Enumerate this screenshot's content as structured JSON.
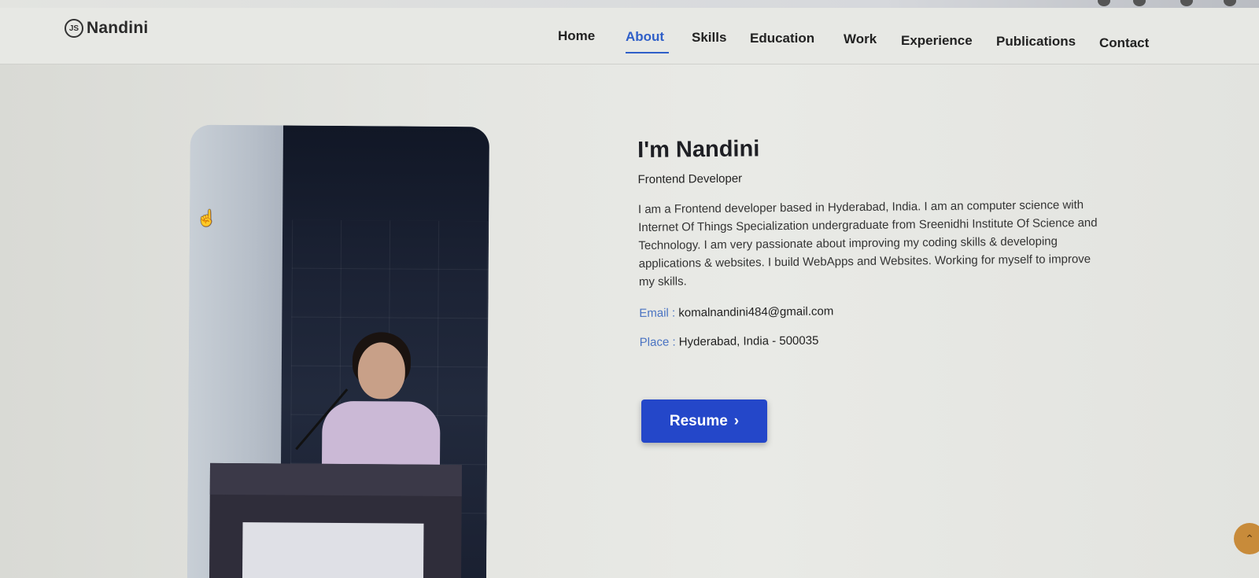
{
  "brand": {
    "logo_text": "JS",
    "name": "Nandini"
  },
  "nav": {
    "items": [
      {
        "label": "Home"
      },
      {
        "label": "About"
      },
      {
        "label": "Skills"
      },
      {
        "label": "Education"
      },
      {
        "label": "Work"
      },
      {
        "label": "Experience"
      },
      {
        "label": "Publications"
      },
      {
        "label": "Contact"
      }
    ],
    "active": "About"
  },
  "about": {
    "heading": "I'm Nandini",
    "role": "Frontend Developer",
    "bio": "I am a Frontend developer based in Hyderabad, India. I am an computer science with Internet Of Things Specialization undergraduate from Sreenidhi Institute Of Science and Technology. I am very passionate about improving my coding skills & developing applications & websites. I build WebApps and Websites. Working for myself to improve my skills.",
    "email_label": "Email :",
    "email": "komalnandini484@gmail.com",
    "place_label": "Place :",
    "place": "Hyderabad, India - 500035",
    "resume_label": "Resume",
    "resume_icon": "chevron-right-icon"
  },
  "colors": {
    "accent": "#2f5fc8",
    "button": "#2447c9",
    "scroll_button": "#c88b3a"
  }
}
